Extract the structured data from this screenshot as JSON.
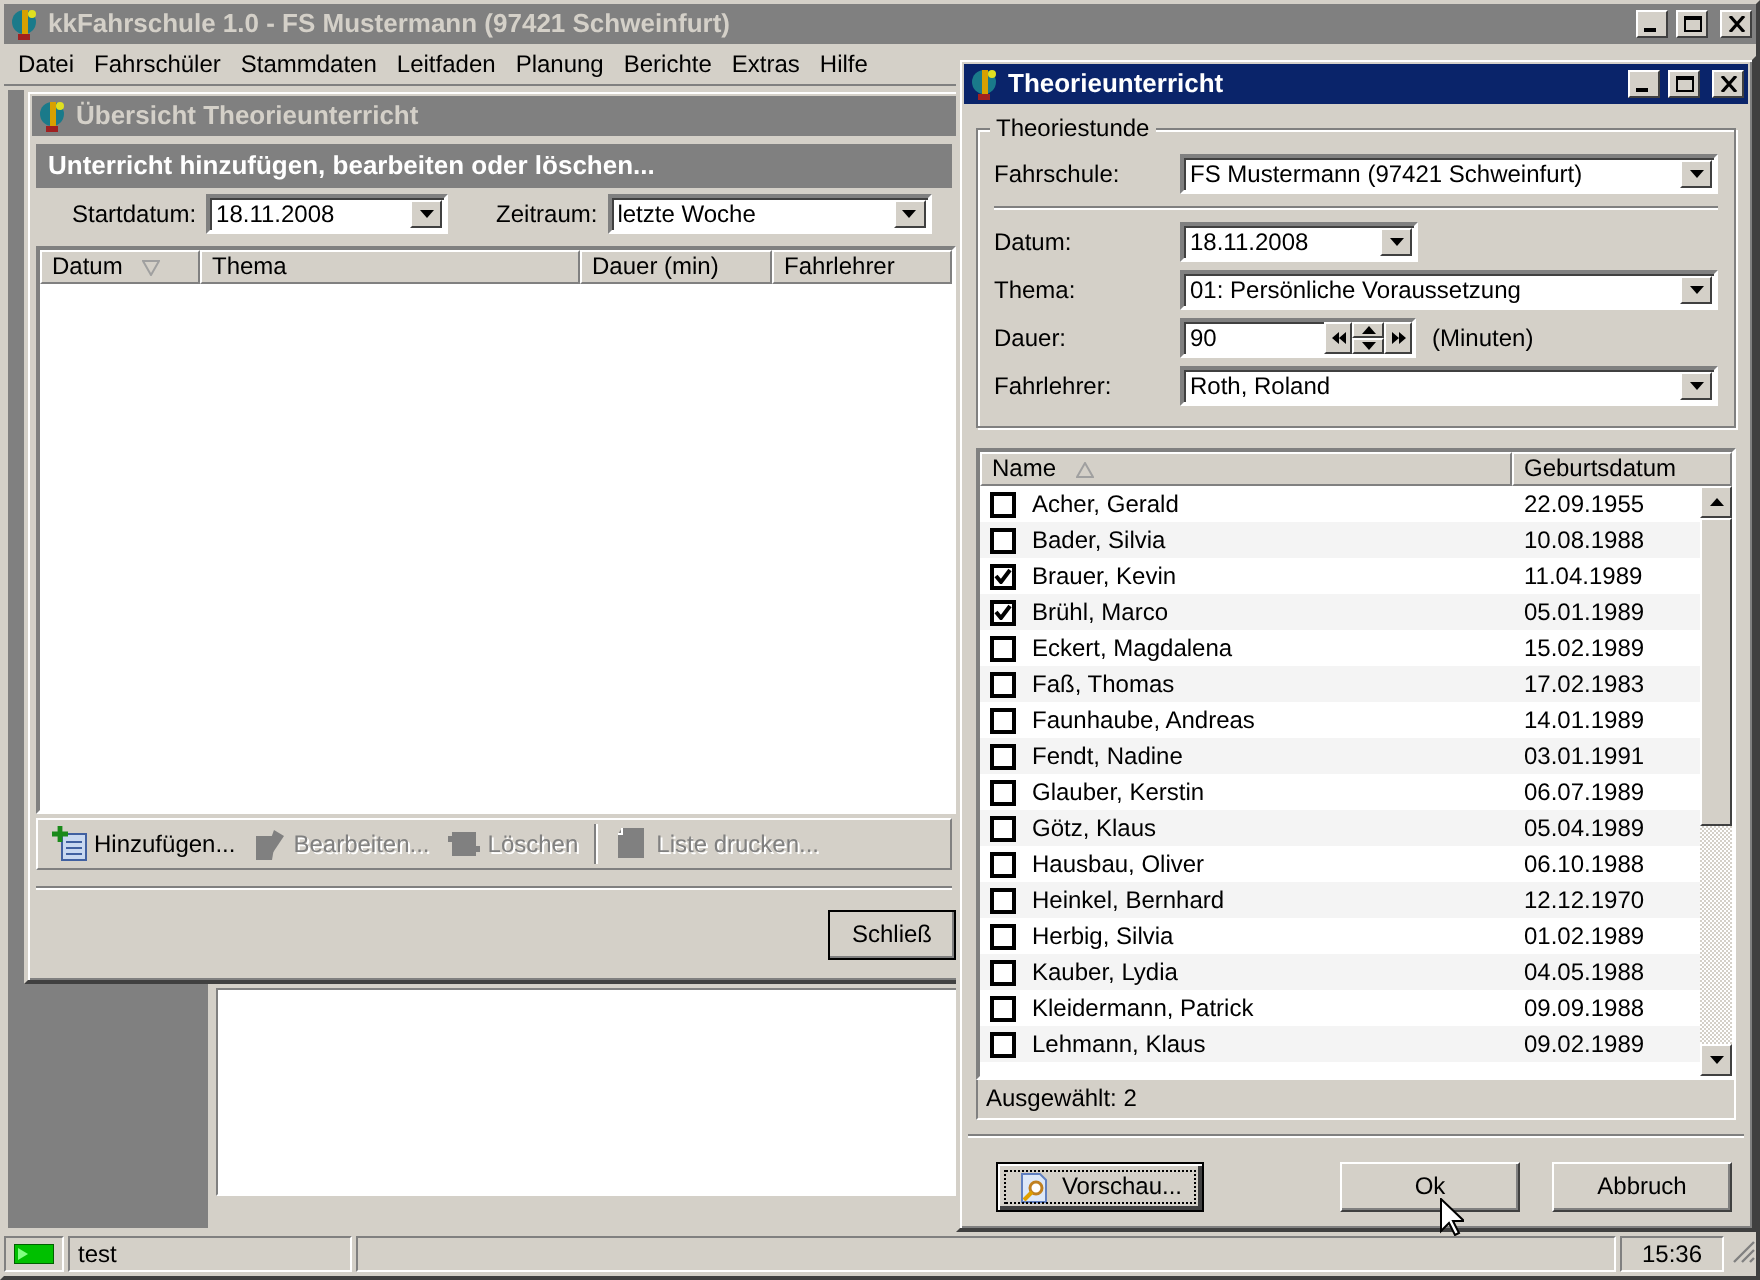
{
  "app_window": {
    "title": "kkFahrschule 1.0 - FS Mustermann (97421 Schweinfurt)",
    "active": false
  },
  "menu": [
    "Datei",
    "Fahrschüler",
    "Stammdaten",
    "Leitfaden",
    "Planung",
    "Berichte",
    "Extras",
    "Hilfe"
  ],
  "overview_window": {
    "title": "Übersicht Theorieunterricht",
    "active": false,
    "heading": "Unterricht hinzufügen, bearbeiten oder löschen...",
    "filters": [
      {
        "label": "Startdatum:",
        "value": "18.11.2008"
      },
      {
        "label": "Zeitraum:",
        "value": "letzte Woche"
      }
    ],
    "columns": [
      {
        "label": "Datum",
        "sorted_descending": true,
        "sorted_ascending": false
      },
      {
        "label": "Thema",
        "sorted_descending": false,
        "sorted_ascending": false
      },
      {
        "label": "Dauer (min)",
        "sorted_descending": false,
        "sorted_ascending": false
      },
      {
        "label": "Fahrlehrer",
        "sorted_descending": false,
        "sorted_ascending": false
      }
    ],
    "toolbar_groups": [
      [
        {
          "kind": "add",
          "label": "Hinzufügen...",
          "disabled": false
        },
        {
          "kind": "edit",
          "label": "Bearbeiten...",
          "disabled": true
        },
        {
          "kind": "delete",
          "label": "Löschen",
          "disabled": true
        }
      ],
      [
        {
          "kind": "print",
          "label": "Liste drucken...",
          "disabled": true
        }
      ]
    ],
    "close_button": "Schließ"
  },
  "dialog": {
    "title": "Theorieunterricht",
    "active": true,
    "group": "Theoriestunde",
    "field_groups": [
      [
        {
          "kind": "combo",
          "label": "Fahrschule:",
          "value": "FS Mustermann (97421 Schweinfurt)"
        }
      ],
      [
        {
          "kind": "date",
          "label": "Datum:",
          "value": "18.11.2008"
        },
        {
          "kind": "combo",
          "label": "Thema:",
          "value": "01: Persönliche Voraussetzung"
        },
        {
          "kind": "spin",
          "label": "Dauer:",
          "value": "90",
          "unit": "(Minuten)"
        },
        {
          "kind": "combo",
          "label": "Fahrlehrer:",
          "value": "Roth, Roland"
        }
      ]
    ],
    "columns": [
      {
        "label": "Name",
        "sorted_descending": false,
        "sorted_ascending": true
      },
      {
        "label": "Geburtsdatum",
        "sorted_descending": false,
        "sorted_ascending": false
      }
    ],
    "students": [
      {
        "name": "Acher, Gerald",
        "birthdate": "22.09.1955",
        "checked": false
      },
      {
        "name": "Bader, Silvia",
        "birthdate": "10.08.1988",
        "checked": false
      },
      {
        "name": "Brauer, Kevin",
        "birthdate": "11.04.1989",
        "checked": true
      },
      {
        "name": "Brühl, Marco",
        "birthdate": "05.01.1989",
        "checked": true
      },
      {
        "name": "Eckert, Magdalena",
        "birthdate": "15.02.1989",
        "checked": false
      },
      {
        "name": "Faß, Thomas",
        "birthdate": "17.02.1983",
        "checked": false
      },
      {
        "name": "Faunhaube, Andreas",
        "birthdate": "14.01.1989",
        "checked": false
      },
      {
        "name": "Fendt, Nadine",
        "birthdate": "03.01.1991",
        "checked": false
      },
      {
        "name": "Glauber, Kerstin",
        "birthdate": "06.07.1989",
        "checked": false
      },
      {
        "name": "Götz, Klaus",
        "birthdate": "05.04.1989",
        "checked": false
      },
      {
        "name": "Hausbau, Oliver",
        "birthdate": "06.10.1988",
        "checked": false
      },
      {
        "name": "Heinkel, Bernhard",
        "birthdate": "12.12.1970",
        "checked": false
      },
      {
        "name": "Herbig, Silvia",
        "birthdate": "01.02.1989",
        "checked": false
      },
      {
        "name": "Kauber, Lydia",
        "birthdate": "04.05.1988",
        "checked": false
      },
      {
        "name": "Kleidermann, Patrick",
        "birthdate": "09.09.1988",
        "checked": false
      },
      {
        "name": "Lehmann, Klaus",
        "birthdate": "09.02.1989",
        "checked": false
      }
    ],
    "selected_count": "Ausgewählt: 2",
    "buttons": [
      {
        "kind": "preview",
        "label": "Vorschau...",
        "focused": true
      },
      {
        "kind": "plain",
        "label": "Ok",
        "focused": false
      },
      {
        "kind": "plain",
        "label": "Abbruch",
        "focused": false
      }
    ]
  },
  "status_bar": {
    "user": "test",
    "time": "15:36"
  }
}
